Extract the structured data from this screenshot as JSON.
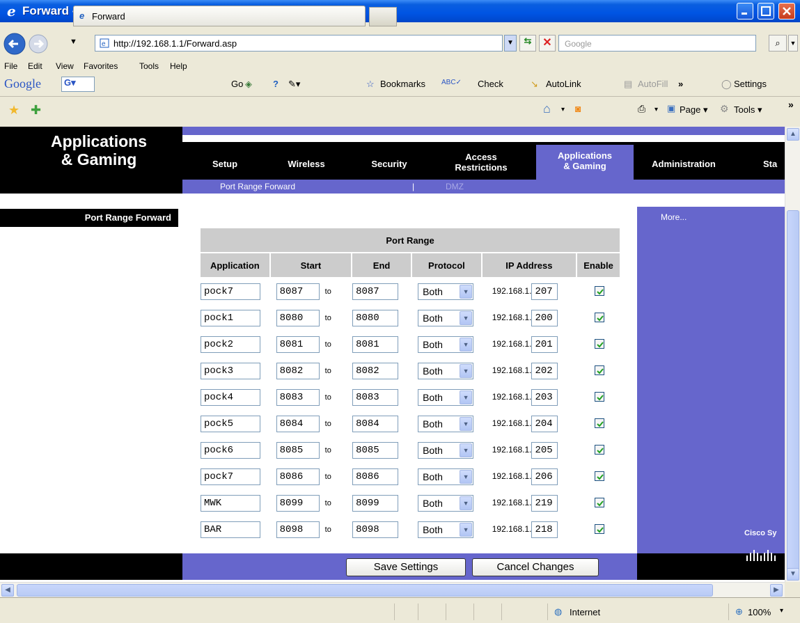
{
  "window": {
    "title": "Forward - Windows Internet Explorer provided by Comcast"
  },
  "address": {
    "url": "http://192.168.1.1/Forward.asp",
    "search_placeholder": "Google"
  },
  "menu": [
    "File",
    "Edit",
    "View",
    "Favorites",
    "Tools",
    "Help"
  ],
  "google_toolbar": {
    "brand": "Google",
    "go": "Go",
    "bookmarks": "Bookmarks",
    "check": "Check",
    "autolink": "AutoLink",
    "autofill": "AutoFill",
    "settings": "Settings"
  },
  "tabs": {
    "active_label": "Forward",
    "page_label": "Page",
    "tools_label": "Tools"
  },
  "router": {
    "section_title_line1": "Applications",
    "section_title_line2": "& Gaming",
    "nav": {
      "setup": "Setup",
      "wireless": "Wireless",
      "security": "Security",
      "access_line1": "Access",
      "access_line2": "Restrictions",
      "apps_line1": "Applications",
      "apps_line2": "& Gaming",
      "administration": "Administration",
      "status": "Sta"
    },
    "subnav": {
      "port_range_forward": "Port Range Forward",
      "separator": "|",
      "dmz": "DMZ"
    },
    "sidebar_title": "Port Range Forward",
    "more": "More...",
    "cisco": "Cisco Sy",
    "table": {
      "group_header": "Port Range",
      "headers": [
        "Application",
        "Start",
        "End",
        "Protocol",
        "IP Address",
        "Enable"
      ],
      "to_label": "to",
      "ip_prefix": "192.168.1.",
      "rows": [
        {
          "app": "pock7",
          "start": "8087",
          "end": "8087",
          "protocol": "Both",
          "ip": "207",
          "enabled": true
        },
        {
          "app": "pock1",
          "start": "8080",
          "end": "8080",
          "protocol": "Both",
          "ip": "200",
          "enabled": true
        },
        {
          "app": "pock2",
          "start": "8081",
          "end": "8081",
          "protocol": "Both",
          "ip": "201",
          "enabled": true
        },
        {
          "app": "pock3",
          "start": "8082",
          "end": "8082",
          "protocol": "Both",
          "ip": "202",
          "enabled": true
        },
        {
          "app": "pock4",
          "start": "8083",
          "end": "8083",
          "protocol": "Both",
          "ip": "203",
          "enabled": true
        },
        {
          "app": "pock5",
          "start": "8084",
          "end": "8084",
          "protocol": "Both",
          "ip": "204",
          "enabled": true
        },
        {
          "app": "pock6",
          "start": "8085",
          "end": "8085",
          "protocol": "Both",
          "ip": "205",
          "enabled": true
        },
        {
          "app": "pock7",
          "start": "8086",
          "end": "8086",
          "protocol": "Both",
          "ip": "206",
          "enabled": true
        },
        {
          "app": "MWK",
          "start": "8099",
          "end": "8099",
          "protocol": "Both",
          "ip": "219",
          "enabled": true
        },
        {
          "app": "BAR",
          "start": "8098",
          "end": "8098",
          "protocol": "Both",
          "ip": "218",
          "enabled": true
        }
      ]
    },
    "buttons": {
      "save": "Save Settings",
      "cancel": "Cancel Changes"
    }
  },
  "status": {
    "zone": "Internet",
    "zoom": "100%"
  },
  "colors": {
    "purple": "#6666cc",
    "black": "#000000",
    "table_header": "#cccccc"
  }
}
